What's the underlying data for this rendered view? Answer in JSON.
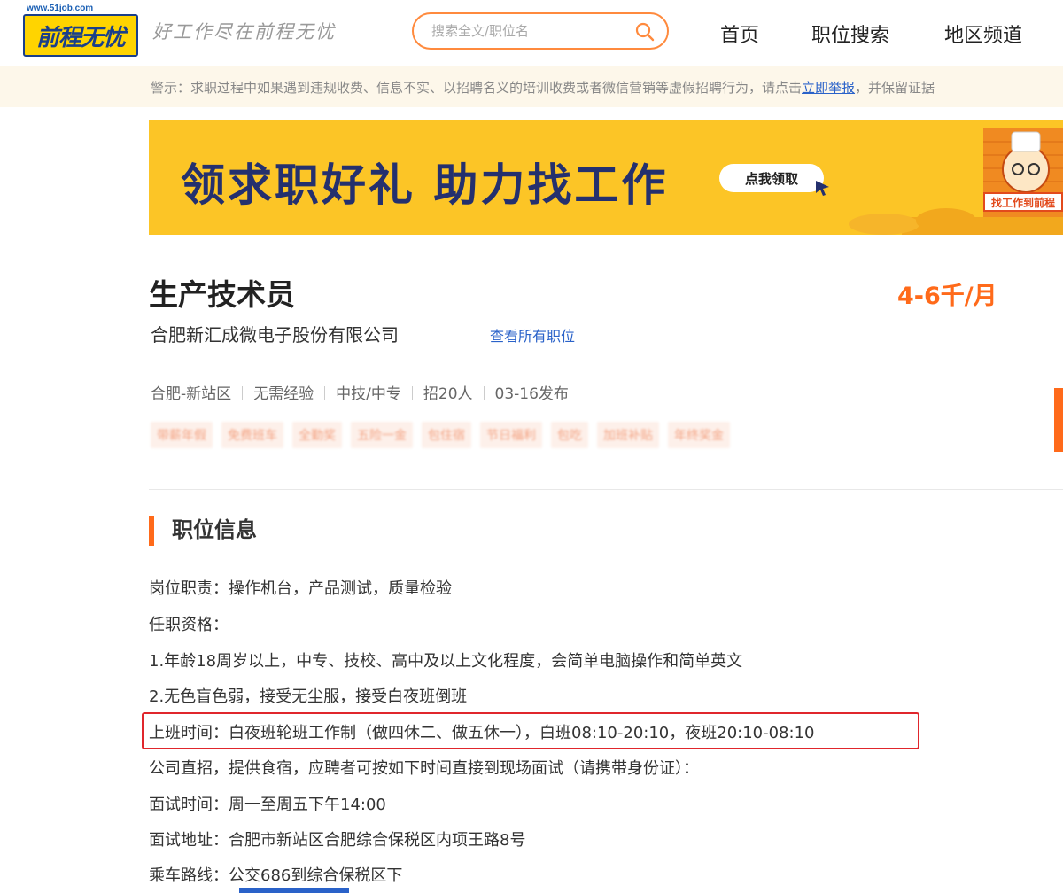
{
  "header": {
    "logo_url": "www.51job.com",
    "logo_text": "前程无忧",
    "slogan": "好工作尽在前程无忧",
    "search_placeholder": "搜索全文/职位名",
    "nav": [
      "首页",
      "职位搜索",
      "地区频道"
    ]
  },
  "warning": {
    "text_before": "警示：求职过程中如果遇到违规收费、信息不实、以招聘名义的培训收费或者微信营销等虚假招聘行为，请点击",
    "link": "立即举报",
    "text_after": "，并保留证据"
  },
  "banner": {
    "headline": "领求职好礼 助力找工作",
    "button": "点我领取",
    "corner_label": "找工作到前程"
  },
  "job": {
    "title": "生产技术员",
    "salary": "4-6千/月",
    "company": "合肥新汇成微电子股份有限公司",
    "view_all": "查看所有职位",
    "meta": [
      "合肥-新站区",
      "无需经验",
      "中技/中专",
      "招20人",
      "03-16发布"
    ],
    "tags": [
      "带薪年假",
      "免费班车",
      "全勤奖",
      "五险一金",
      "包住宿",
      "节日福利",
      "包吃",
      "加班补贴",
      "年终奖金"
    ]
  },
  "section": {
    "title": "职位信息",
    "lines": [
      "岗位职责：操作机台，产品测试，质量检验",
      "任职资格：",
      "1.年龄18周岁以上，中专、技校、高中及以上文化程度，会简单电脑操作和简单英文",
      "2.无色盲色弱，接受无尘服，接受白夜班倒班",
      "上班时间：白夜班轮班工作制（做四休二、做五休一），白班08:10-20:10，夜班20:10-08:10",
      "公司直招，提供食宿，应聘者可按如下时间直接到现场面试（请携带身份证）：",
      "面试时间：周一至周五下午14:00",
      "面试地址：合肥市新站区合肥综合保税区内项王路8号",
      "乘车路线：公交686到综合保税区下"
    ]
  },
  "colors": {
    "accent": "#ff6a1a",
    "link": "#2a62c9",
    "highlight_border": "#e0262c",
    "banner_bg": "#fcc526"
  }
}
